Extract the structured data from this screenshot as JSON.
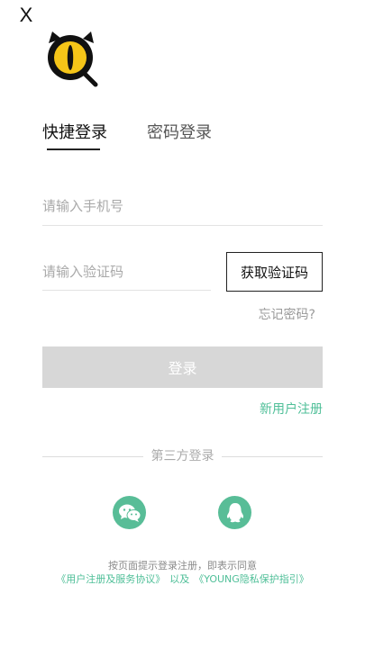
{
  "header": {
    "close_label": "X"
  },
  "tabs": {
    "quick_login": "快捷登录",
    "password_login": "密码登录"
  },
  "form": {
    "phone_placeholder": "请输入手机号",
    "code_placeholder": "请输入验证码",
    "get_code_label": "获取验证码",
    "forgot_password": "忘记密码?",
    "login_label": "登录",
    "register_label": "新用户注册"
  },
  "third_party": {
    "label": "第三方登录",
    "options": [
      "wechat-icon",
      "qq-icon"
    ]
  },
  "agreement": {
    "text": "按页面提示登录注册，即表示同意",
    "user_agreement": "《用户注册及服务协议》",
    "joiner": "以及",
    "privacy": "《YOUNG隐私保护指引》"
  },
  "colors": {
    "accent": "#4fbf98",
    "social": "#58bd97",
    "login_disabled": "#d7d7d7",
    "logo_yellow": "#f5c518"
  }
}
